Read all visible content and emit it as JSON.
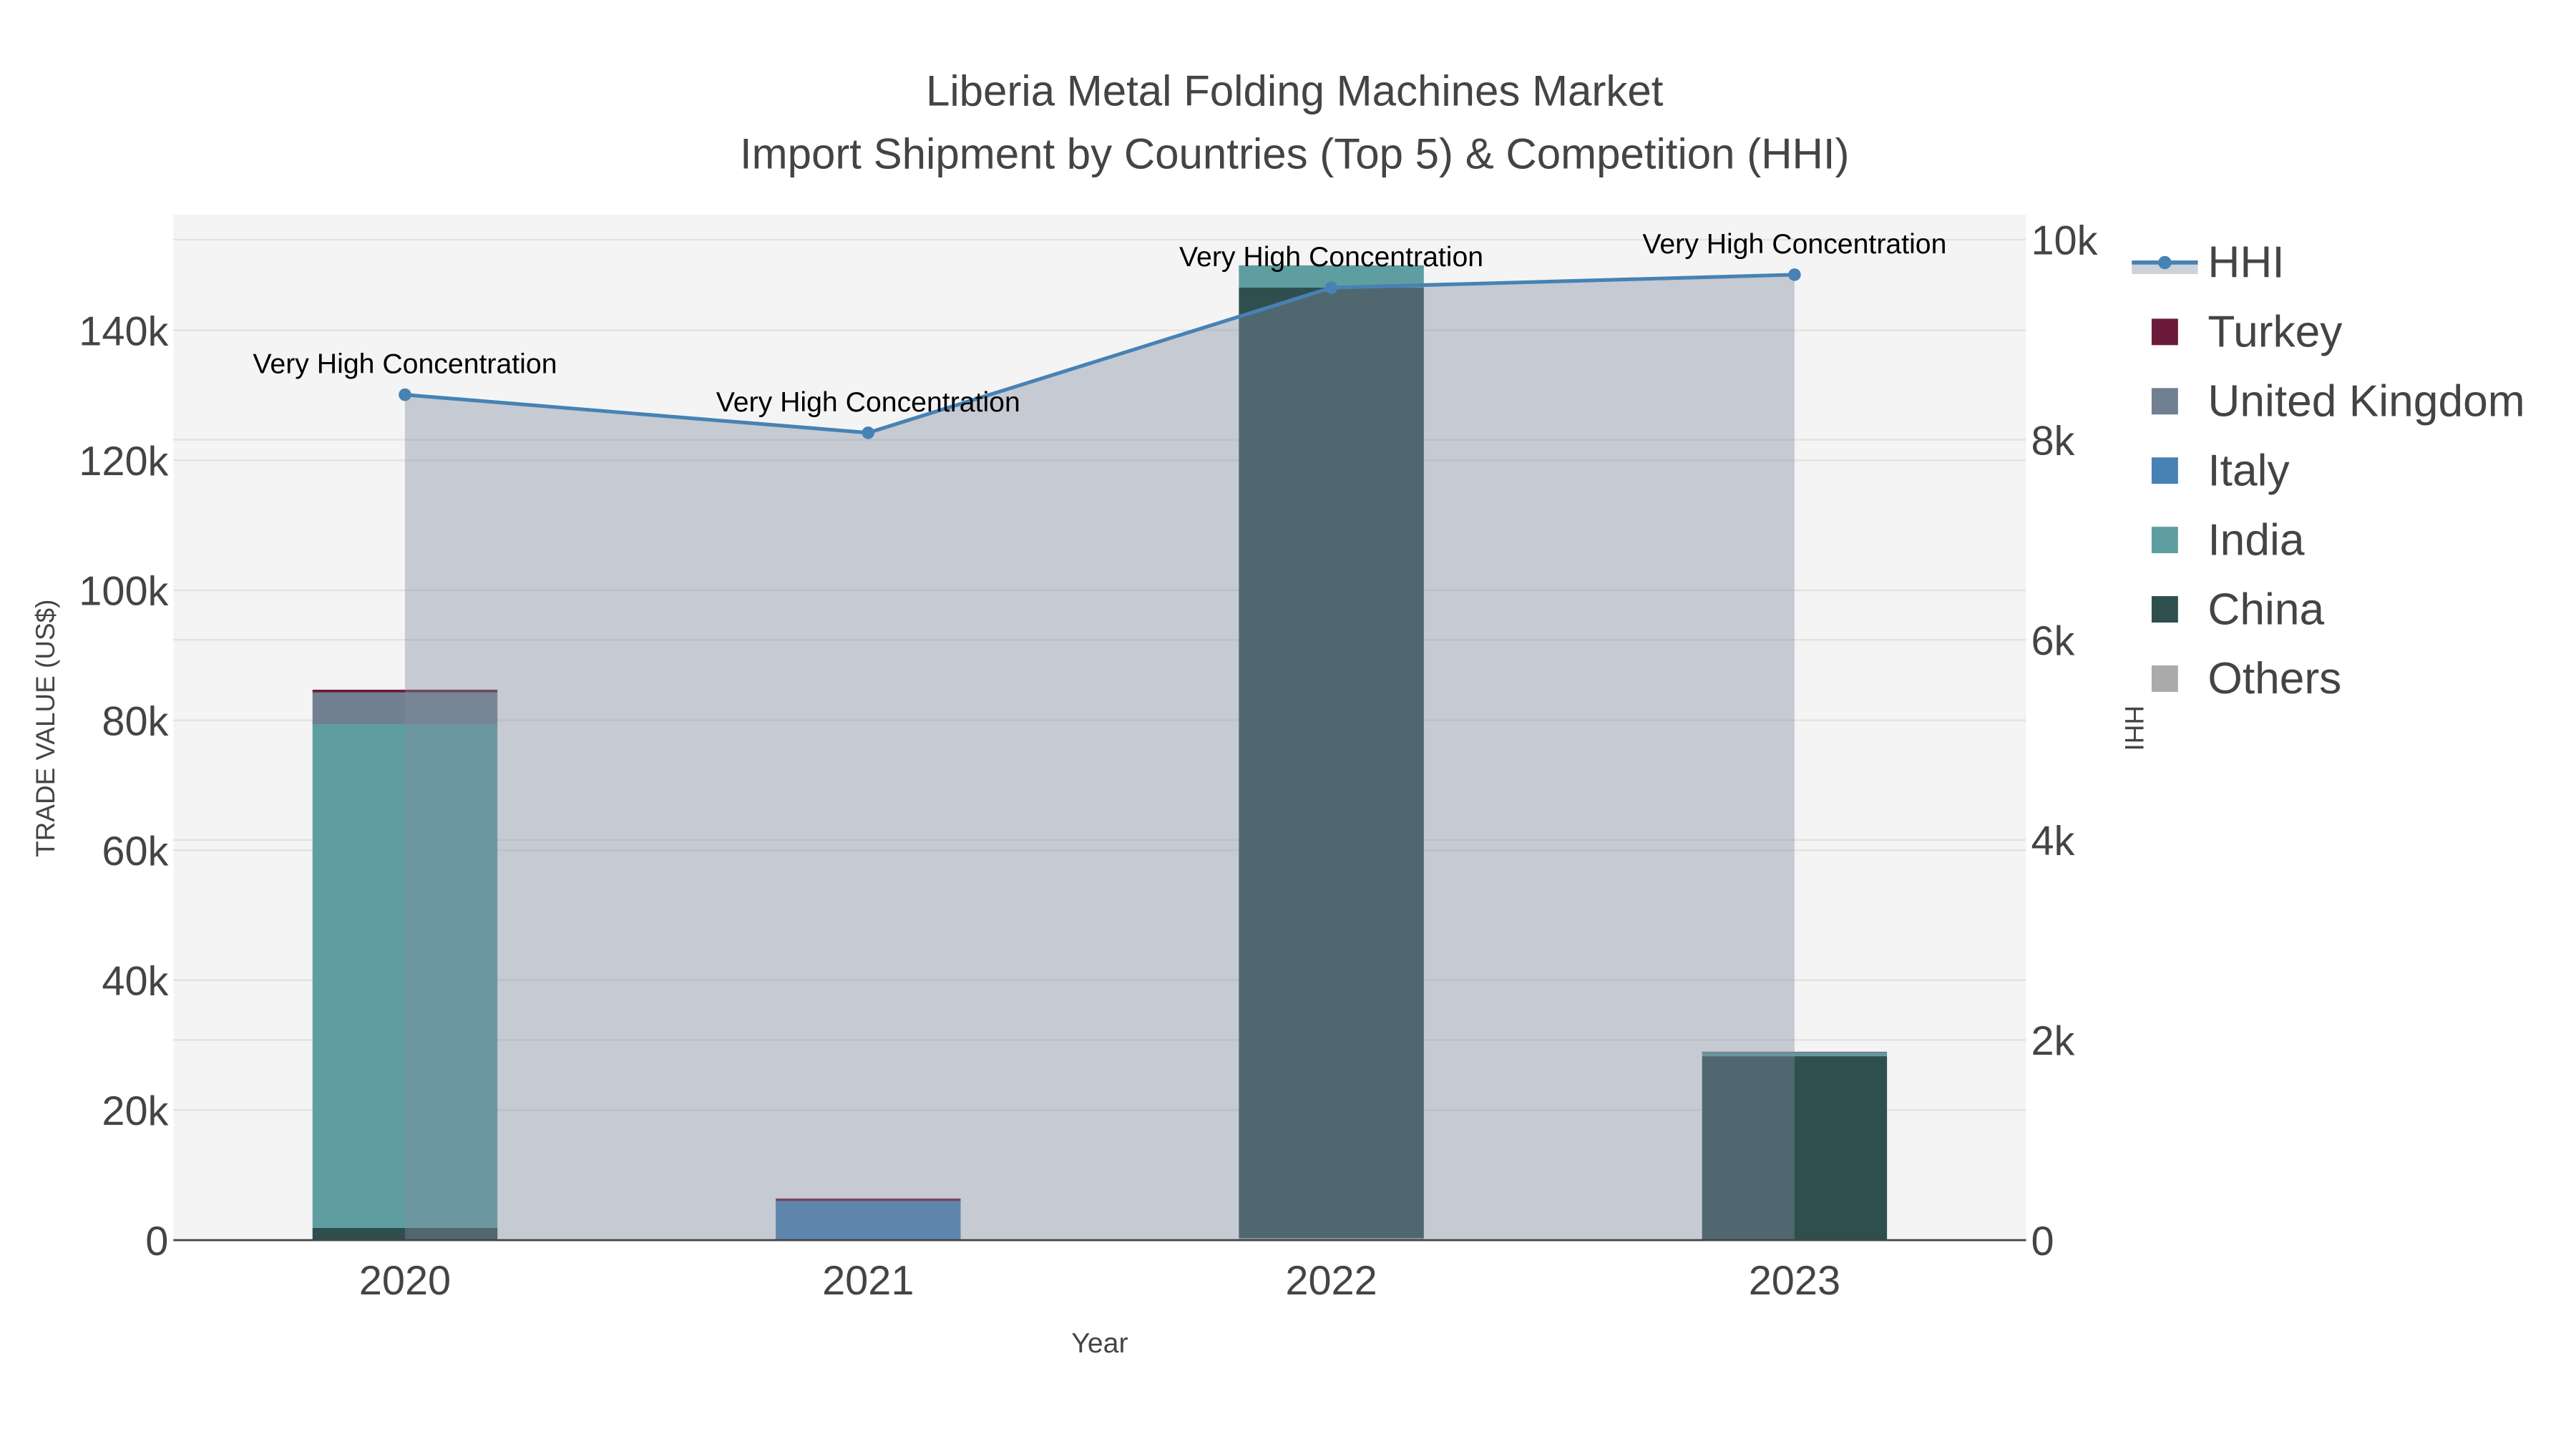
{
  "chart_data": {
    "type": "bar",
    "title_line1": "Liberia Metal Folding Machines Market",
    "title_line2": "Import Shipment by Countries (Top 5) & Competition (HHI)",
    "xlabel": "Year",
    "ylabel": "TRADE VALUE (US$)",
    "y2label": "HHI",
    "categories": [
      "2020",
      "2021",
      "2022",
      "2023"
    ],
    "ylim": [
      0,
      157800
    ],
    "y2lim": [
      0,
      10250
    ],
    "yticks": [
      {
        "v": 0,
        "label": "0"
      },
      {
        "v": 20000,
        "label": "20k"
      },
      {
        "v": 40000,
        "label": "40k"
      },
      {
        "v": 60000,
        "label": "60k"
      },
      {
        "v": 80000,
        "label": "80k"
      },
      {
        "v": 100000,
        "label": "100k"
      },
      {
        "v": 120000,
        "label": "120k"
      },
      {
        "v": 140000,
        "label": "140k"
      }
    ],
    "y2ticks": [
      {
        "v": 0,
        "label": "0"
      },
      {
        "v": 2000,
        "label": "2k"
      },
      {
        "v": 4000,
        "label": "4k"
      },
      {
        "v": 6000,
        "label": "6k"
      },
      {
        "v": 8000,
        "label": "8k"
      },
      {
        "v": 10000,
        "label": "10k"
      }
    ],
    "series": [
      {
        "name": "Others",
        "color": "#aaaaaa",
        "values": [
          0,
          0,
          300,
          0
        ]
      },
      {
        "name": "China",
        "color": "#2f4f4f",
        "values": [
          1900,
          0,
          146300,
          28300
        ]
      },
      {
        "name": "India",
        "color": "#5f9ea0",
        "values": [
          77500,
          0,
          3400,
          400
        ]
      },
      {
        "name": "Italy",
        "color": "#4682b4",
        "values": [
          0,
          6000,
          0,
          0
        ]
      },
      {
        "name": "United Kingdom",
        "color": "#708090",
        "values": [
          4900,
          0,
          0,
          300
        ]
      },
      {
        "name": "Turkey",
        "color": "#6b1a3a",
        "values": [
          400,
          400,
          0,
          0
        ]
      }
    ],
    "hhi": {
      "name": "HHI",
      "color": "#4682b4",
      "values": [
        8450,
        8070,
        9520,
        9650
      ],
      "annotations": [
        "Very High Concentration",
        "Very High Concentration",
        "Very High Concentration",
        "Very High Concentration"
      ]
    },
    "legend": [
      "HHI",
      "Turkey",
      "United Kingdom",
      "Italy",
      "India",
      "China",
      "Others"
    ],
    "legend_placement": "right",
    "grid": true
  }
}
